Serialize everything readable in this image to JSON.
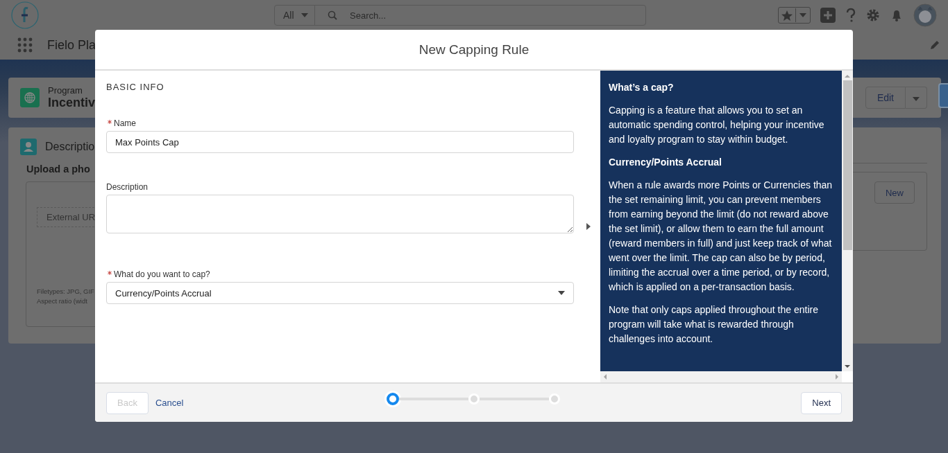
{
  "header": {
    "search_scope": "All",
    "search_placeholder": "Search..."
  },
  "nav": {
    "app_name": "Fielo Pla"
  },
  "record": {
    "object_label": "Program",
    "name": "Incentiv",
    "actions": [
      "Edit"
    ]
  },
  "description_card": {
    "title": "Descriptio",
    "upload_heading": "Upload a pho",
    "external_url": "External UR",
    "filetypes": "Filetypes: JPG, GIF",
    "aspect_ratio": "Aspect ratio (widt",
    "new_button": "New"
  },
  "modal": {
    "title": "New Capping Rule",
    "section": "BASIC INFO",
    "fields": [
      {
        "kind": "text",
        "label": "Name",
        "required": true,
        "value": "Max Points Cap"
      },
      {
        "kind": "textarea",
        "label": "Description",
        "required": false
      },
      {
        "kind": "select",
        "label": "What do you want to cap?",
        "required": true,
        "value": "Currency/Points Accrual"
      }
    ],
    "help": [
      {
        "kind": "heading",
        "text": "What’s a cap?"
      },
      {
        "kind": "text",
        "text": "Capping is a feature that allows you to set an automatic spending control, helping your incentive and loyalty program to stay within budget."
      },
      {
        "kind": "heading",
        "text": "Currency/Points Accrual"
      },
      {
        "kind": "text",
        "text": "When a rule awards more Points or Currencies than the set remaining limit, you can prevent members from earning beyond the limit (do not reward above the set limit), or allow them to earn the full amount (reward members in full) and just keep track of what went over the limit. The cap can also be by period, limiting the accrual over a time period, or by record, which is applied on a per-transaction basis."
      },
      {
        "kind": "text",
        "text": "Note that only caps applied throughout the entire program will take what is rewarded through challenges into account."
      }
    ],
    "footer": {
      "back": {
        "label": "Back",
        "disabled": true
      },
      "cancel": "Cancel",
      "next": {
        "label": "Next",
        "disabled": false
      }
    },
    "steps": [
      {
        "selected": true
      },
      {
        "selected": false
      },
      {
        "selected": false
      }
    ]
  }
}
